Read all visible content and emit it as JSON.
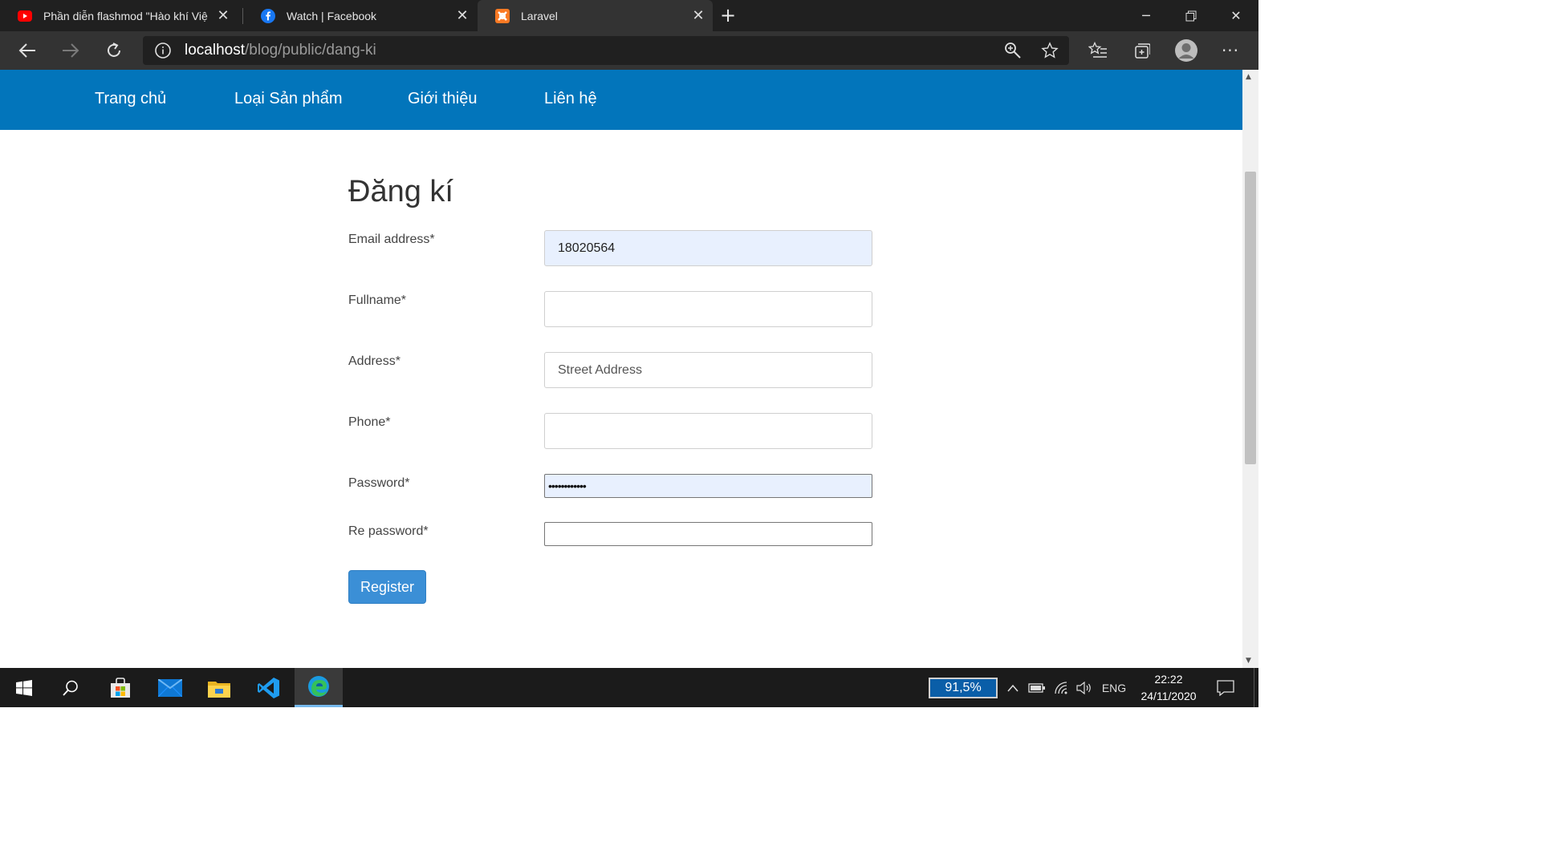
{
  "browser": {
    "tabs": [
      {
        "title": "Phần diễn flashmod \"Hào khí Việ",
        "icon": "youtube-icon"
      },
      {
        "title": "Watch | Facebook",
        "icon": "facebook-icon"
      },
      {
        "title": "Laravel",
        "icon": "xampp-icon"
      }
    ],
    "url": {
      "host": "localhost",
      "path": "/blog/public/dang-ki"
    }
  },
  "site_nav": {
    "items": [
      "Trang chủ",
      "Loại Sản phẩm",
      "Giới thiệu",
      "Liên hệ"
    ]
  },
  "form": {
    "title": "Đăng kí",
    "fields": [
      {
        "label": "Email address*",
        "value": "18020564"
      },
      {
        "label": "Fullname*",
        "value": ""
      },
      {
        "label": "Address*",
        "placeholder": "Street Address"
      },
      {
        "label": "Phone*",
        "value": ""
      },
      {
        "label": "Password*",
        "masked": "••••••••••••"
      },
      {
        "label": "Re password*",
        "value": ""
      }
    ],
    "submit_label": "Register"
  },
  "taskbar": {
    "battery": "91,5%",
    "language": "ENG",
    "time": "22:22",
    "date": "24/11/2020",
    "pinned": [
      "windows-start-icon",
      "search-icon",
      "store-icon",
      "mail-icon",
      "file-explorer-icon",
      "vscode-icon",
      "edge-icon"
    ]
  },
  "colors": {
    "nav_bg": "#0275bb",
    "button": "#3b8fd6",
    "autofill": "#e8f0fe"
  }
}
